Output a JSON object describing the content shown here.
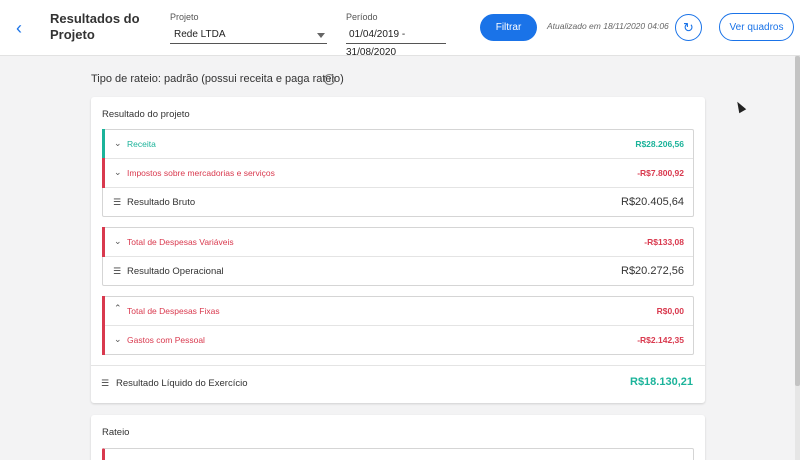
{
  "header": {
    "back_icon": "chevron-left-icon",
    "title": "Resultados do Projeto",
    "project_label": "Projeto",
    "project_value": "Rede LTDA",
    "period_label": "Período",
    "period_value": "01/04/2019 - 31/08/2020",
    "filter_label": "Filtrar",
    "updated_text": "Atualizado em 18/11/2020 04:06",
    "refresh_icon": "refresh-icon",
    "view_boards_label": "Ver quadros"
  },
  "rateio_type": "Tipo de rateio: padrão (possui receita e paga rateio)",
  "result_card": {
    "title": "Resultado do projeto",
    "group1": {
      "receita": {
        "label": "Receita",
        "value": "R$28.206,56"
      },
      "impostos": {
        "label": "Impostos sobre mercadorias e serviços",
        "value": "-R$7.800,92"
      },
      "bruto": {
        "label": "Resultado Bruto",
        "value": "R$20.405,64"
      }
    },
    "group2": {
      "variaveis": {
        "label": "Total de Despesas Variáveis",
        "value": "-R$133,08"
      },
      "operacional": {
        "label": "Resultado Operacional",
        "value": "R$20.272,56"
      }
    },
    "group3": {
      "fixas": {
        "label": "Total de Despesas Fixas",
        "value": "R$0,00"
      },
      "pessoal": {
        "label": "Gastos com Pessoal",
        "value": "-R$2.142,35"
      }
    },
    "net": {
      "label": "Resultado Líquido do Exercício",
      "value": "R$18.130,21"
    }
  },
  "rateio_card": {
    "title": "Rateio"
  },
  "colors": {
    "accent": "#1a73e8",
    "positive": "#1bb39a",
    "negative": "#d9394e"
  }
}
